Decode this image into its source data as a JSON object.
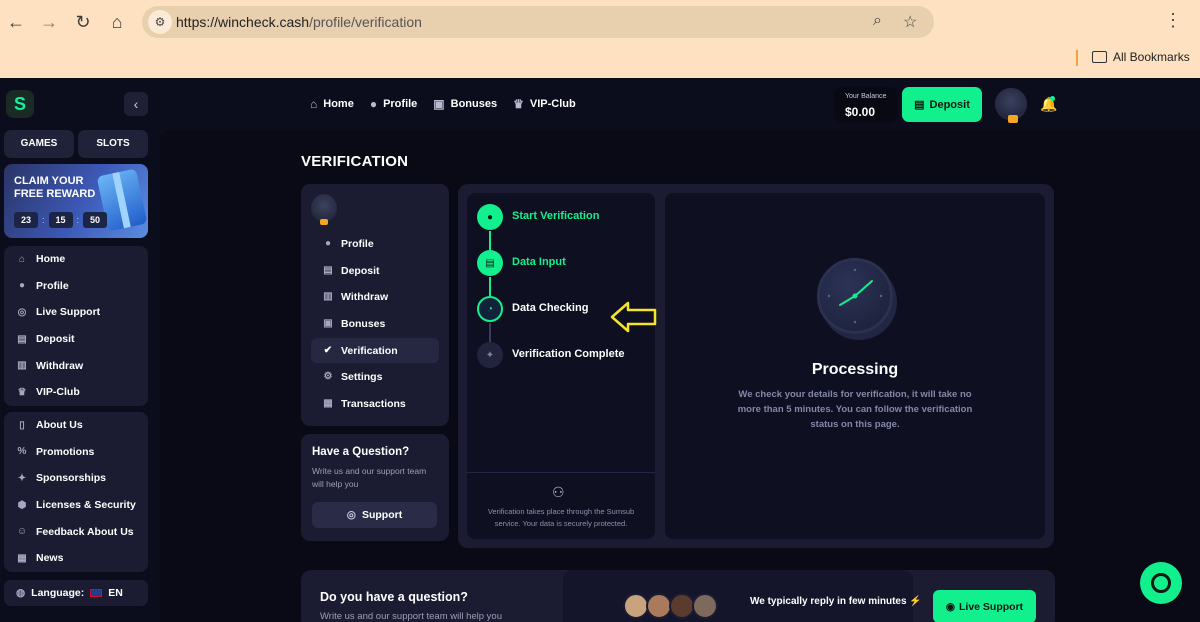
{
  "browser": {
    "url_host": "https://wincheck.cash",
    "url_path": "/profile/verification",
    "bookmarks_label": "All Bookmarks"
  },
  "topnav": [
    {
      "icon": "home-icon",
      "label": "Home"
    },
    {
      "icon": "user-icon",
      "label": "Profile"
    },
    {
      "icon": "gift-icon",
      "label": "Bonuses"
    },
    {
      "icon": "crown-icon",
      "label": "VIP-Club"
    }
  ],
  "header": {
    "balance_label": "Your Balance",
    "balance_value": "$0.00",
    "deposit_label": "Deposit"
  },
  "sidebar": {
    "games_label": "GAMES",
    "slots_label": "SLOTS",
    "reward": {
      "title": "CLAIM YOUR FREE REWARD",
      "timer": [
        "23",
        "15",
        "50"
      ]
    },
    "main_items": [
      {
        "icon": "home-icon",
        "label": "Home"
      },
      {
        "icon": "user-icon",
        "label": "Profile"
      },
      {
        "icon": "headset-icon",
        "label": "Live Support"
      },
      {
        "icon": "wallet-icon",
        "label": "Deposit"
      },
      {
        "icon": "withdraw-icon",
        "label": "Withdraw"
      },
      {
        "icon": "crown-icon",
        "label": "VIP-Club"
      }
    ],
    "info_items": [
      {
        "icon": "book-icon",
        "label": "About Us"
      },
      {
        "icon": "percent-icon",
        "label": "Promotions"
      },
      {
        "icon": "handshake-icon",
        "label": "Sponsorships"
      },
      {
        "icon": "shield-icon",
        "label": "Licenses & Security"
      },
      {
        "icon": "feedback-icon",
        "label": "Feedback About Us"
      },
      {
        "icon": "news-icon",
        "label": "News"
      }
    ],
    "language_label": "Language:",
    "language_value": "EN"
  },
  "page": {
    "title": "VERIFICATION"
  },
  "profile_menu": [
    {
      "icon": "user-icon",
      "label": "Profile",
      "active": false
    },
    {
      "icon": "wallet-icon",
      "label": "Deposit",
      "active": false
    },
    {
      "icon": "withdraw-icon",
      "label": "Withdraw",
      "active": false
    },
    {
      "icon": "gift-icon",
      "label": "Bonuses",
      "active": false
    },
    {
      "icon": "check-badge-icon",
      "label": "Verification",
      "active": true
    },
    {
      "icon": "gear-icon",
      "label": "Settings",
      "active": false
    },
    {
      "icon": "transactions-icon",
      "label": "Transactions",
      "active": false
    }
  ],
  "question": {
    "title": "Have a Question?",
    "desc": "Write us and our support team will help you",
    "button": "Support"
  },
  "steps": [
    {
      "label": "Start Verification",
      "state": "done"
    },
    {
      "label": "Data Input",
      "state": "done"
    },
    {
      "label": "Data Checking",
      "state": "current"
    },
    {
      "label": "Verification Complete",
      "state": "pending"
    }
  ],
  "sumsub_note": "Verification takes place through the Sumsub service. Your data is securely protected.",
  "processing": {
    "title": "Processing",
    "desc": "We check your details for verification, it will take no more than 5 minutes. You can follow the verification status on this page."
  },
  "bottom": {
    "title": "Do you have a question?",
    "desc": "Write us and our support team will help you",
    "reply_text": "We typically reply in few minutes",
    "live_support": "Live Support"
  },
  "colors": {
    "accent": "#12f08e",
    "panel": "#1b1c31",
    "arrow": "#f5e52a"
  }
}
